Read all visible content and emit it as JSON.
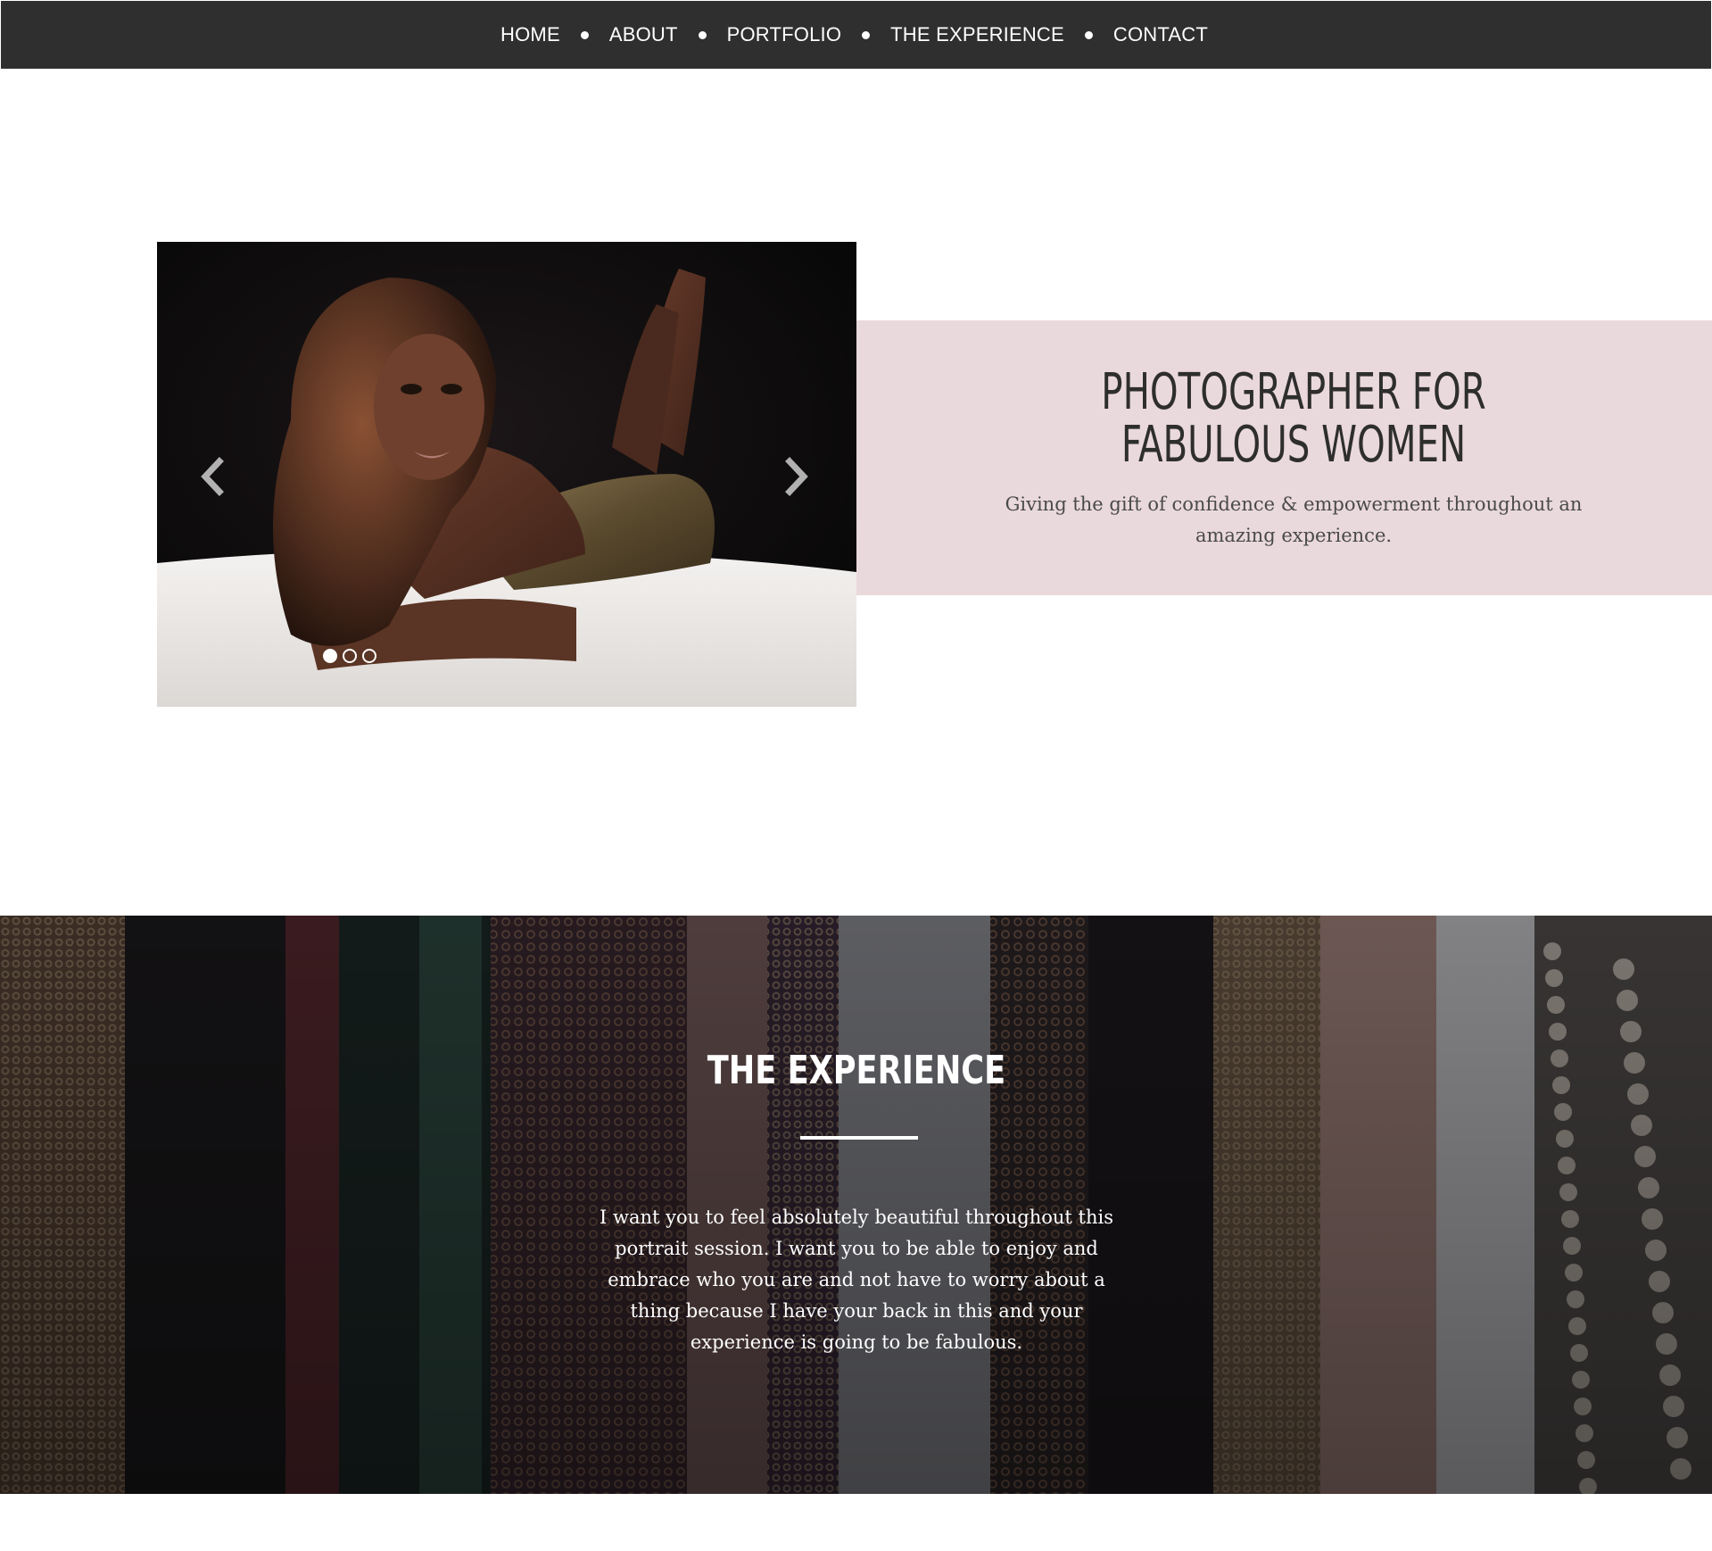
{
  "nav": {
    "items": [
      {
        "label": "HOME"
      },
      {
        "label": "ABOUT"
      },
      {
        "label": "PORTFOLIO"
      },
      {
        "label": "THE EXPERIENCE"
      },
      {
        "label": "CONTACT"
      }
    ],
    "separator_icon": "bullet-dot-icon"
  },
  "hero": {
    "title_line1": "PHOTOGRAPHER FOR",
    "title_line2": "FABULOUS WOMEN",
    "subtitle": "Giving the gift of confidence & empowerment throughout an amazing experience.",
    "slider": {
      "prev_icon": "chevron-left-icon",
      "next_icon": "chevron-right-icon",
      "slide_count": 3,
      "active_slide": 1
    },
    "panel_color": "#ead9dc"
  },
  "experience": {
    "title": "THE EXPERIENCE",
    "body": "I want you to feel absolutely beautiful throughout this portrait session. I want you to be able to enjoy and embrace who you are and not have to worry about a thing because I have your back in this and your experience is going to be fabulous."
  },
  "colors": {
    "nav_bg": "#2f2f2f",
    "accent_pink": "#ead9dc",
    "heading_text": "#2e2e2e"
  }
}
